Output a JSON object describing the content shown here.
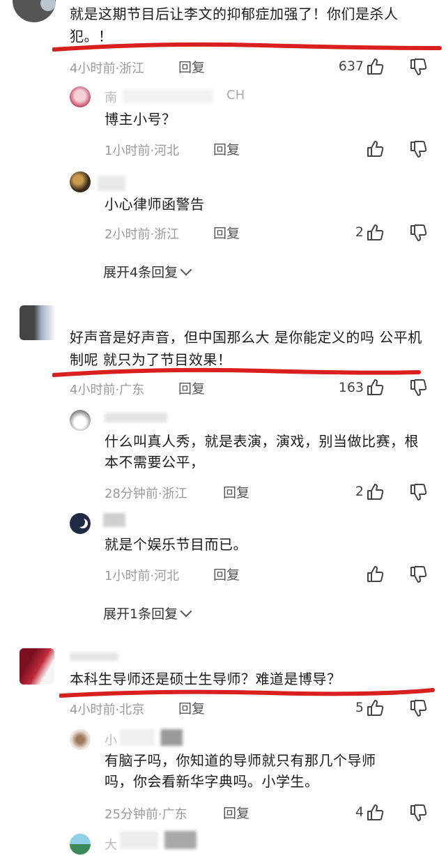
{
  "threads": [
    {
      "text": "就是这期节目后让李文的抑郁症加强了！你们是杀人犯。！",
      "meta": "4小时前·浙江",
      "reply": "回复",
      "likes": "637",
      "replies": [
        {
          "username": "南",
          "username_tail": "CH",
          "text": "博主小号？",
          "meta": "1小时前·河北",
          "reply": "回复",
          "likes": ""
        },
        {
          "username": "",
          "text": "小心律师函警告",
          "meta": "2小时前·浙江",
          "reply": "回复",
          "likes": "2"
        }
      ],
      "expand": "展开4条回复"
    },
    {
      "text": "好声音是好声音，但中国那么大 是你能定义的吗 公平机制呢 就只为了节目效果！",
      "meta": "4小时前·广东",
      "reply": "回复",
      "likes": "163",
      "replies": [
        {
          "username": "",
          "text": "什么叫真人秀，就是表演，演戏，别当做比赛，根本不需要公平，",
          "meta": "28分钟前·浙江",
          "reply": "回复",
          "likes": "2"
        },
        {
          "username": "",
          "text": "就是个娱乐节目而已。",
          "meta": "1小时前·河北",
          "reply": "回复",
          "likes": ""
        }
      ],
      "expand": "展开1条回复"
    },
    {
      "text": "本科生导师还是硕士生导师？难道是博导？",
      "meta": "4小时前·北京",
      "reply": "回复",
      "likes": "5",
      "replies": [
        {
          "username": "小",
          "text": "有脑子吗，你知道的导师就只有那几个导师吗，你会看新华字典吗。小学生。",
          "meta": "25分钟前·广东",
          "reply": "回复",
          "likes": "4"
        },
        {
          "username": "大",
          "text": "",
          "meta": "",
          "reply": "",
          "likes": ""
        }
      ]
    }
  ],
  "colors": {
    "underline": "#d9201e",
    "meta": "#9a9a9a"
  }
}
